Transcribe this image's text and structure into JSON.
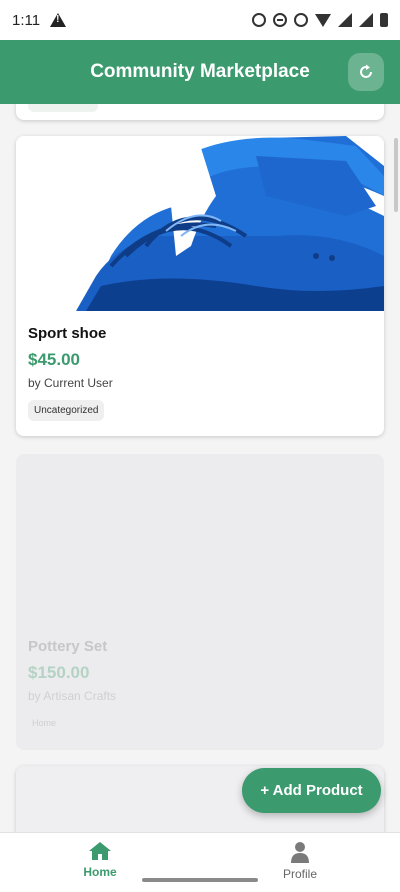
{
  "status_bar": {
    "time": "1:11",
    "icons": [
      "alert-icon",
      "alarm-icon",
      "do-not-disturb-icon",
      "wifi-calling-icon",
      "wifi-icon",
      "signal-r-icon",
      "signal-r-icon",
      "battery-icon"
    ]
  },
  "app_bar": {
    "title": "Community Marketplace",
    "refresh_icon": "refresh-icon",
    "accent_color": "#3b9a6e"
  },
  "products": [
    {
      "title": "Sport shoe",
      "price": "$45.00",
      "seller": "by Current User",
      "tag": "Uncategorized",
      "image": "blue-running-shoe"
    },
    {
      "title": "Pottery Set",
      "price": "$150.00",
      "seller": "by Artisan Crafts",
      "tag": "Home",
      "state": "loading-faded"
    }
  ],
  "fab": {
    "label": "+ Add Product"
  },
  "bottom_nav": {
    "items": [
      {
        "label": "Home",
        "icon": "home-icon",
        "active": true
      },
      {
        "label": "Profile",
        "icon": "person-icon",
        "active": false
      }
    ]
  }
}
